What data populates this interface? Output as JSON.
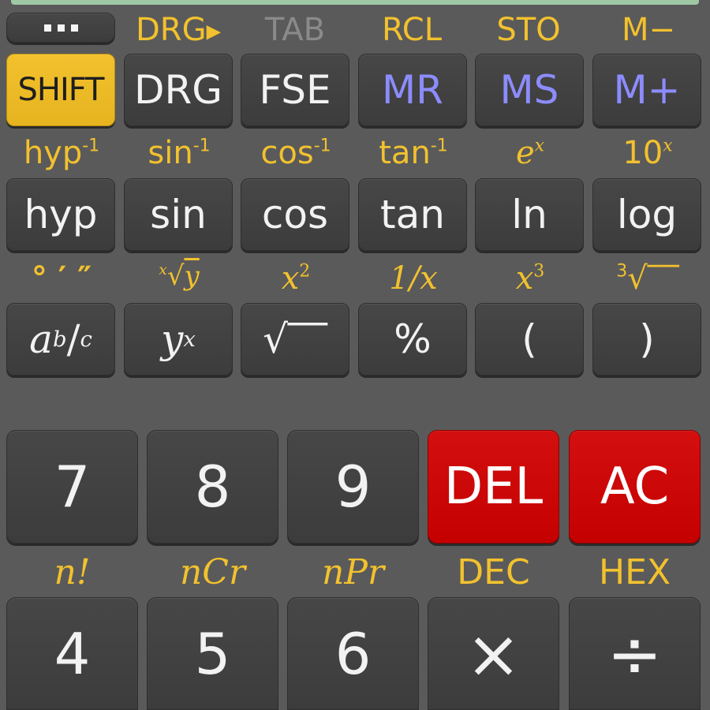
{
  "top_row": {
    "menu_icon": "ellipsis-icon",
    "labels": [
      "DRG",
      "TAB",
      "RCL",
      "STO",
      "M−"
    ]
  },
  "row1": {
    "shift": "SHIFT",
    "drg": "DRG",
    "fse": "FSE",
    "mr": "MR",
    "ms": "MS",
    "mplus": "M+"
  },
  "row2_shift": [
    "hyp",
    "-1",
    "sin",
    "-1",
    "cos",
    "-1",
    "tan",
    "-1",
    "e",
    "x",
    "10",
    "x"
  ],
  "row2": [
    "hyp",
    "sin",
    "cos",
    "tan",
    "ln",
    "log"
  ],
  "row3_shift": [
    "° ′ ″",
    "x",
    "√",
    "y",
    "x",
    "2",
    "1/x",
    "x",
    "3",
    "3",
    "√‾‾"
  ],
  "row3": [
    "a",
    "b",
    "/",
    "c",
    "y",
    "x",
    "√‾‾",
    "%",
    "(",
    ")"
  ],
  "numpad_row1": [
    "7",
    "8",
    "9",
    "DEL",
    "AC"
  ],
  "numpad_shift": [
    "n!",
    "nCr",
    "nPr",
    "DEC",
    "HEX"
  ],
  "numpad_row2": [
    "4",
    "5",
    "6",
    "×",
    "÷"
  ],
  "colors": {
    "background": "#5a5a5a",
    "key": "#424242",
    "shift_label": "#f2c12e",
    "memory_text": "#8c8cff",
    "red_key": "#cc0000",
    "shift_key": "#efbe27"
  }
}
